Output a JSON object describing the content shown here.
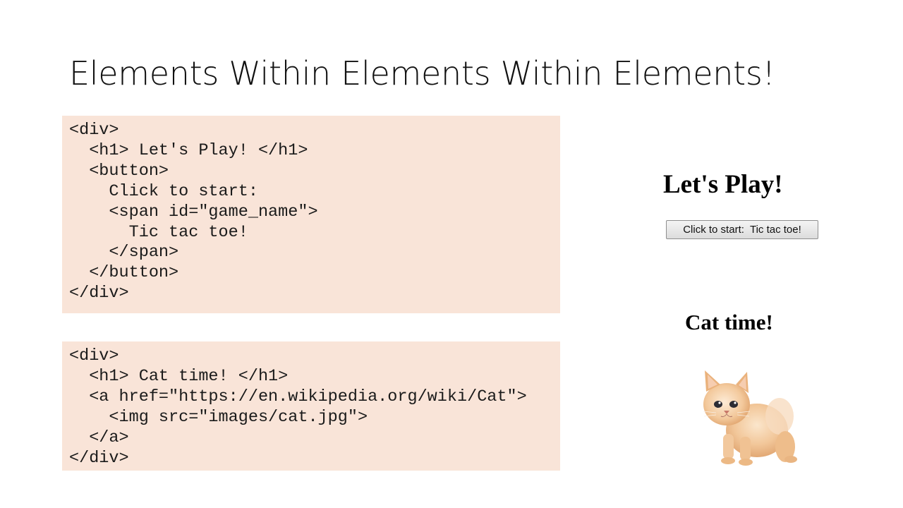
{
  "slide": {
    "title": "Elements Within Elements Within Elements!"
  },
  "code_blocks": [
    {
      "lines": [
        "<div>",
        "  <h1> Let's Play! </h1>",
        "  <button>",
        "    Click to start:",
        "    <span id=\"game_name\">",
        "      Tic tac toe!",
        "    </span>",
        "  </button>",
        "</div>"
      ]
    },
    {
      "lines": [
        "<div>",
        "  <h1> Cat time! </h1>",
        "  <a href=\"https://en.wikipedia.org/wiki/Cat\">",
        "    <img src=\"images/cat.jpg\">",
        "  </a>",
        "</div>"
      ]
    }
  ],
  "preview": {
    "heading_1": "Let's Play!",
    "button_label": "Click to start:  Tic tac toe!",
    "heading_2": "Cat time!",
    "image": "kitten-photo"
  },
  "colors": {
    "code_background": "#f9e4d8",
    "kitten_fur": "#f2c79a"
  }
}
